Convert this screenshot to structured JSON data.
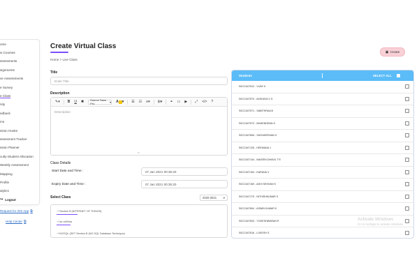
{
  "sidebar": {
    "items": [
      {
        "label": "ome"
      },
      {
        "label": "w Courses"
      },
      {
        "label": "ssessments"
      },
      {
        "label": "signments"
      },
      {
        "label": "ve Assessments"
      },
      {
        "label": "e Survey"
      },
      {
        "label": "e Class",
        "active": true
      },
      {
        "label": "nity"
      },
      {
        "label": "edback"
      },
      {
        "label": "ms"
      },
      {
        "label": "ssion Hooks"
      },
      {
        "label": "ssessment Tracker"
      },
      {
        "label": "ssion Planner"
      },
      {
        "label": "culty-Student Allocation"
      },
      {
        "label": "Weekly Assessment"
      },
      {
        "label": "Mapping"
      },
      {
        "label": "Profile"
      },
      {
        "label": "alytics"
      }
    ],
    "logout_label": "Logout",
    "ios_link": "Request for IOS App",
    "help_link": "Help Center"
  },
  "header": {
    "title": "Create Virtual Class",
    "breadcrumb": "Home > Live Class",
    "create_label": "Create"
  },
  "form": {
    "title_label": "Title",
    "title_placeholder": "Enter Title",
    "description_label": "Description",
    "description_placeholder": "Description",
    "font_name": "Source Sans Pro",
    "class_details_label": "Class Details",
    "start_label": "Start Date and Time :",
    "start_value": "07 Jan 2021 00:35:20",
    "expiry_label": "Expiry Date and Time :",
    "expiry_value": "07 Jan 2021 00:35:20",
    "select_class_label": "Select Class",
    "year_value": "2020-2021",
    "classes": [
      "Section B [INTERNET OF THINGS]",
      "se-mHhba",
      "NOSQL (SET Section B (NO SQL Database Technique)"
    ]
  },
  "students_panel": {
    "header_students": "Students",
    "header_select_all": "SELECT ALL",
    "rows": [
      "S0CCU07512 - VIJAY K",
      "S0CCU07570 - AKSHAYA V G",
      "S0CCU07571 - SABITHRAA B",
      "S0CCU07573 - MAHENDRAN G",
      "S0CCU07606 - SUDHARSHAN G",
      "S0CCU07126 - HEEMANA J",
      "S0CCU07144 - NAVEEN DHAVU T R",
      "S0CCU07154 - KARANA V",
      "S0CCU07169 - ADHI SESHAN S",
      "S0CCU07179 - NITHISHKUMAR S",
      "S0CCU07604 - ASWIN KUMAR K",
      "S0CCU07503 - YOGESHWARAN R",
      "S0CCU07616 - LOKESH S",
      "S0CCU07555 - PADMA G"
    ]
  },
  "watermark": {
    "line1": "Activate Windows",
    "line2": "Go to Settings to activate Windows."
  }
}
